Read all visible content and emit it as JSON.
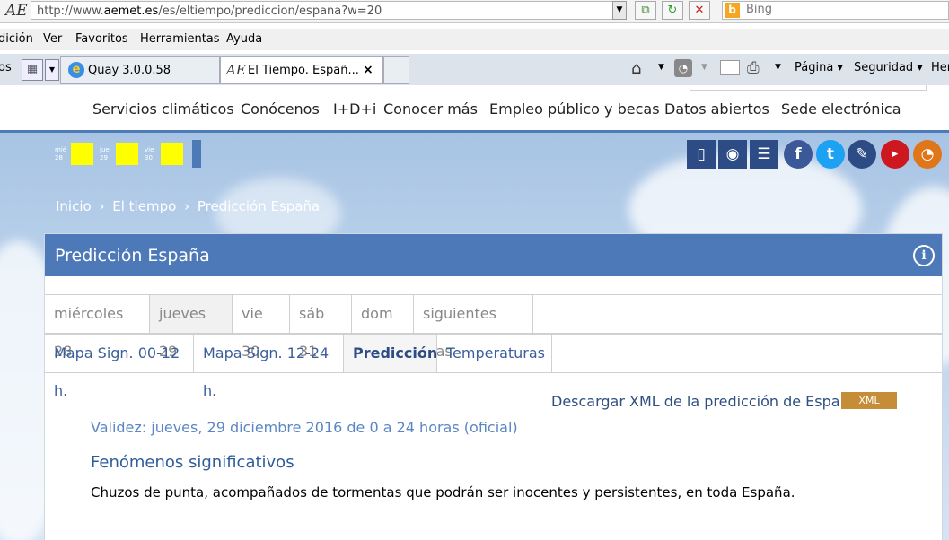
{
  "browser": {
    "url_prefix": "http://www.",
    "url_domain": "aemet.es",
    "url_rest": "/es/eltiempo/prediccion/espana?w=20",
    "search_placeholder": "Bing",
    "logo_text": "AE",
    "menu": [
      "dición",
      "Ver",
      "Favoritos",
      "Herramientas",
      "Ayuda"
    ],
    "tabs": [
      {
        "label": "Quay 3.0.0.58"
      },
      {
        "label": "El Tiempo. Españ...",
        "close": "×"
      }
    ],
    "left_fragment": "os",
    "commands": [
      "Página ▾",
      "Seguridad ▾",
      "Her"
    ]
  },
  "site_nav": [
    "Servicios climáticos",
    "Conócenos",
    "I+D+i",
    "Conocer más",
    "Empleo público y becas",
    "Datos abiertos",
    "Sede electrónica"
  ],
  "day_blocks": [
    {
      "day": "mié",
      "num": "28"
    },
    {
      "day": "jue",
      "num": "29"
    },
    {
      "day": "vie",
      "num": "30"
    }
  ],
  "breadcrumb": [
    "Inicio",
    "›",
    "El tiempo",
    "›",
    "Predicción España"
  ],
  "panel": {
    "title": "Predicción España",
    "info_icon": "i",
    "day_tabs": [
      "miércoles 28",
      "jueves 29",
      "vie 30",
      "sáb 31",
      "dom 1",
      "siguientes días"
    ],
    "view_tabs": [
      "Mapa Sign. 00-12 h.",
      "Mapa Sign. 12-24 h.",
      "Predicción",
      "Temperaturas"
    ],
    "download_label": "Descargar XML de la predicción de España",
    "xml_badge": "XML",
    "validity": "Validez: jueves, 29 diciembre 2016 de 0 a 24 horas (oficial)",
    "section_title": "Fenómenos significativos",
    "description": "Chuzos de punta, acompañados de tormentas que podrán ser inocentes y persistentes, en toda España."
  },
  "colors": {
    "header_blue": "#4d79b9",
    "xml_badge": "#c58d38",
    "day_yellow": "#ffff00"
  }
}
